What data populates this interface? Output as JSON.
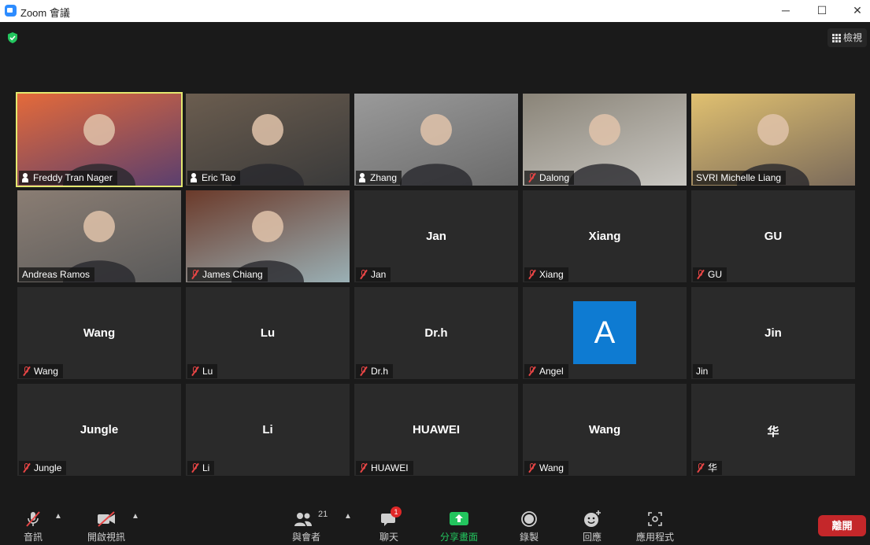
{
  "window": {
    "title": "Zoom 會議",
    "minimize": "─",
    "maximize": "☐",
    "close": "✕"
  },
  "view_button": "檢視",
  "participants": [
    {
      "name": "Freddy Tran Nager",
      "label": "Freddy Tran Nager",
      "mic": "speaking",
      "active": true,
      "video": true
    },
    {
      "name": "Eric Tao",
      "label": "Eric Tao",
      "mic": "speaking",
      "video": true
    },
    {
      "name": "Zhang",
      "label": "Zhang",
      "mic": "speaking",
      "video": true
    },
    {
      "name": "Dalong",
      "label": "Dalong",
      "mic": "muted",
      "video": true
    },
    {
      "name": "SVRI Michelle Liang",
      "label": "SVRI Michelle Liang",
      "mic": "none",
      "video": true
    },
    {
      "name": "Andreas Ramos",
      "label": "Andreas Ramos",
      "mic": "none",
      "video": true
    },
    {
      "name": "James Chiang",
      "label": "James Chiang",
      "mic": "muted",
      "video": true
    },
    {
      "name": "Jan",
      "label": "Jan",
      "mic": "muted",
      "video": false
    },
    {
      "name": "Xiang",
      "label": "Xiang",
      "mic": "muted",
      "video": false
    },
    {
      "name": "GU",
      "label": "GU",
      "mic": "muted",
      "video": false
    },
    {
      "name": "Wang",
      "label": "Wang",
      "mic": "muted",
      "video": false
    },
    {
      "name": "Lu",
      "label": "Lu",
      "mic": "muted",
      "video": false
    },
    {
      "name": "Dr.h",
      "label": "Dr.h",
      "mic": "muted",
      "video": false
    },
    {
      "name": "A",
      "label": "Angel",
      "mic": "muted",
      "video": false,
      "avatar": true
    },
    {
      "name": "Jin",
      "label": "Jin",
      "mic": "none",
      "video": false
    },
    {
      "name": "Jungle",
      "label": "Jungle",
      "mic": "muted",
      "video": false
    },
    {
      "name": "Li",
      "label": "Li",
      "mic": "muted",
      "video": false
    },
    {
      "name": "HUAWEI",
      "label": "HUAWEI",
      "mic": "muted",
      "video": false
    },
    {
      "name": "Wang",
      "label": "Wang",
      "mic": "muted",
      "video": false
    },
    {
      "name": "华",
      "label": "华",
      "mic": "muted",
      "video": false
    }
  ],
  "toolbar": {
    "audio": "音訊",
    "video": "開啟視訊",
    "participants": "與會者",
    "participant_count": "21",
    "chat": "聊天",
    "chat_badge": "1",
    "share": "分享畫面",
    "record": "錄製",
    "reactions": "回應",
    "apps": "應用程式",
    "leave": "離開"
  },
  "colors": {
    "active_speaker": "#e3e86f",
    "share_green": "#23c55e",
    "leave_red": "#c4272a",
    "avatar_blue": "#0e7bd2",
    "muted_red": "#e64545"
  }
}
